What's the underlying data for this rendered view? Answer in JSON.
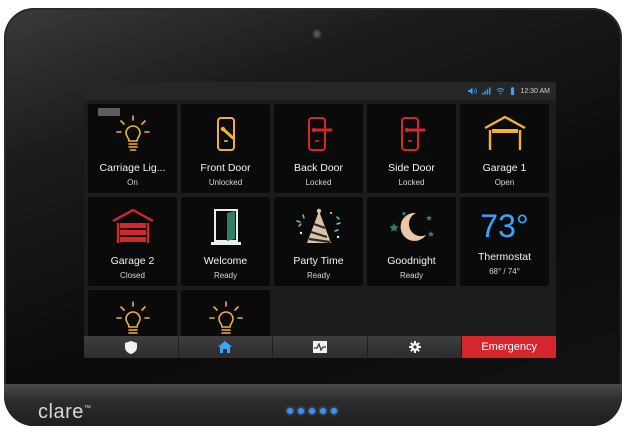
{
  "status": {
    "time": "12:30 AM"
  },
  "tiles": [
    {
      "name": "Carriage Lig...",
      "state": "On",
      "icon": "lightbulb-icon"
    },
    {
      "name": "Front Door",
      "state": "Unlocked",
      "icon": "unlocked-door-icon"
    },
    {
      "name": "Back Door",
      "state": "Locked",
      "icon": "locked-door-icon"
    },
    {
      "name": "Side Door",
      "state": "Locked",
      "icon": "locked-door-icon"
    },
    {
      "name": "Garage 1",
      "state": "Open",
      "icon": "garage-open-icon"
    },
    {
      "name": "Garage 2",
      "state": "Closed",
      "icon": "garage-closed-icon"
    },
    {
      "name": "Welcome",
      "state": "Ready",
      "icon": "open-door-icon"
    },
    {
      "name": "Party Time",
      "state": "Ready",
      "icon": "party-hat-icon"
    },
    {
      "name": "Goodnight",
      "state": "Ready",
      "icon": "moon-stars-icon"
    },
    {
      "name": "Thermostat",
      "state": "68° / 74°",
      "temp": "73°",
      "icon": "thermostat-icon"
    }
  ],
  "nav": {
    "emergency": "Emergency"
  },
  "brand": "clare",
  "colors": {
    "accent": "#39a7ff",
    "gold": "#f0b232",
    "red": "#d5262e",
    "emergency": "#d5262e"
  }
}
